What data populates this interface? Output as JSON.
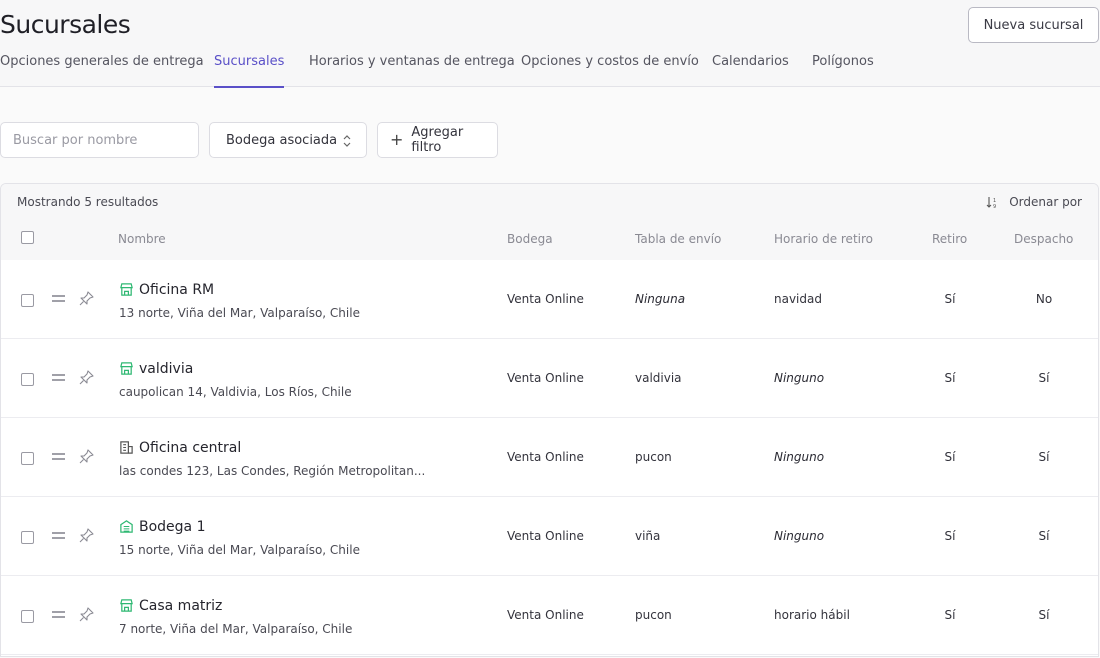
{
  "header": {
    "title": "Sucursales",
    "new_button": "Nueva sucursal",
    "tabs": [
      {
        "label": "Opciones generales de entrega",
        "active": false
      },
      {
        "label": "Sucursales",
        "active": true
      },
      {
        "label": "Horarios y ventanas de entrega",
        "active": false
      },
      {
        "label": "Opciones y costos de envío",
        "active": false
      },
      {
        "label": "Calendarios",
        "active": false
      },
      {
        "label": "Polígonos",
        "active": false
      }
    ]
  },
  "filters": {
    "search_placeholder": "Buscar por nombre",
    "warehouse_select": "Bodega asociada",
    "add_filter": "Agregar filtro"
  },
  "table": {
    "results_text": "Mostrando 5 resultados",
    "sort_label": "Ordenar por",
    "columns": [
      "Nombre",
      "Bodega",
      "Tabla de envío",
      "Horario de retiro",
      "Retiro",
      "Despacho"
    ],
    "rows": [
      {
        "icon": "store-icon",
        "name": "Oficina RM",
        "address": "13 norte, Viña del Mar, Valparaíso, Chile",
        "bodega": "Venta Online",
        "tabla": "Ninguna",
        "tabla_empty": true,
        "horario": "navidad",
        "horario_empty": false,
        "retiro": "Sí",
        "despacho": "No"
      },
      {
        "icon": "store-icon",
        "name": "valdivia",
        "address": "caupolican 14, Valdivia, Los Ríos, Chile",
        "bodega": "Venta Online",
        "tabla": "valdivia",
        "tabla_empty": false,
        "horario": "Ninguno",
        "horario_empty": true,
        "retiro": "Sí",
        "despacho": "Sí"
      },
      {
        "icon": "office-building-icon",
        "name": "Oficina central",
        "address": "las condes 123, Las Condes, Región Metropolitan...",
        "bodega": "Venta Online",
        "tabla": "pucon",
        "tabla_empty": false,
        "horario": "Ninguno",
        "horario_empty": true,
        "retiro": "Sí",
        "despacho": "Sí"
      },
      {
        "icon": "warehouse-icon",
        "name": "Bodega 1",
        "address": "15 norte, Viña del Mar, Valparaíso, Chile",
        "bodega": "Venta Online",
        "tabla": "viña",
        "tabla_empty": false,
        "horario": "Ninguno",
        "horario_empty": true,
        "retiro": "Sí",
        "despacho": "Sí"
      },
      {
        "icon": "store-icon",
        "name": "Casa matriz",
        "address": "7 norte, Viña del Mar, Valparaíso, Chile",
        "bodega": "Venta Online",
        "tabla": "pucon",
        "tabla_empty": false,
        "horario": "horario hábil",
        "horario_empty": false,
        "retiro": "Sí",
        "despacho": "Sí"
      }
    ]
  },
  "colors": {
    "accent": "#5a50c8",
    "icon_green": "#2eb872"
  }
}
